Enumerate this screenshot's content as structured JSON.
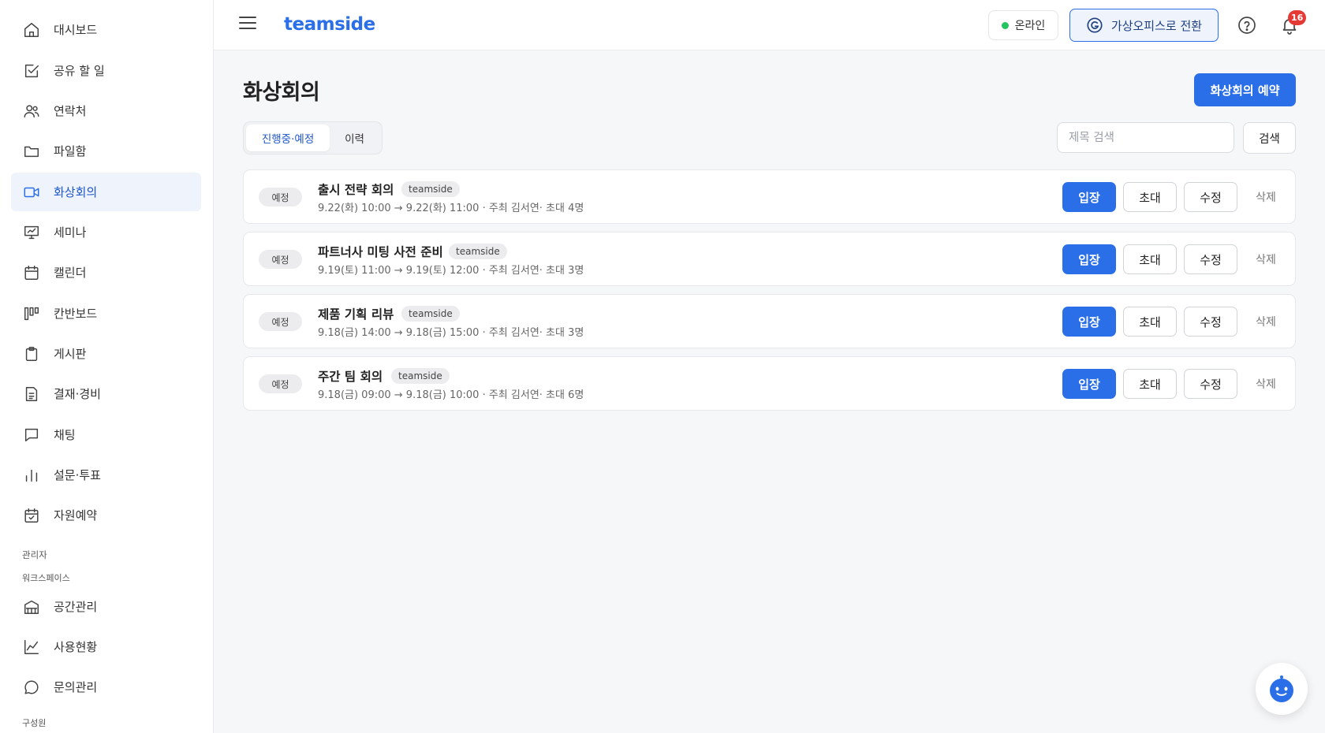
{
  "sidebar": {
    "items": [
      {
        "label": "대시보드",
        "icon": "home-icon"
      },
      {
        "label": "공유 할 일",
        "icon": "checkbox-icon"
      },
      {
        "label": "연락처",
        "icon": "users-icon"
      },
      {
        "label": "파일함",
        "icon": "folder-icon"
      },
      {
        "label": "화상회의",
        "icon": "video-icon"
      },
      {
        "label": "세미나",
        "icon": "presentation-icon"
      },
      {
        "label": "캘린더",
        "icon": "calendar-icon"
      },
      {
        "label": "칸반보드",
        "icon": "kanban-icon"
      },
      {
        "label": "게시판",
        "icon": "clipboard-icon"
      },
      {
        "label": "결재·경비",
        "icon": "document-icon"
      },
      {
        "label": "채팅",
        "icon": "chat-icon"
      },
      {
        "label": "설문·투표",
        "icon": "bar-chart-icon"
      },
      {
        "label": "자원예약",
        "icon": "calendar-check-icon"
      }
    ],
    "admin_label": "관리자",
    "workspace_label": "워크스페이스",
    "admin_items": [
      {
        "label": "공간관리",
        "icon": "building-icon"
      },
      {
        "label": "사용현황",
        "icon": "line-chart-icon"
      },
      {
        "label": "문의관리",
        "icon": "message-circle-icon"
      }
    ],
    "members_label": "구성원"
  },
  "header": {
    "logo": "teamside",
    "status": "온라인",
    "status_color": "#22c55e",
    "virtual_office_label": "가상오피스로 전환",
    "notification_count": "16"
  },
  "main": {
    "title": "화상회의",
    "reserve_button": "화상회의 예약",
    "tabs": [
      {
        "label": "진행중·예정",
        "active": true
      },
      {
        "label": "이력",
        "active": false
      }
    ],
    "search": {
      "placeholder": "제목 검색",
      "button": "검색"
    },
    "meetings": [
      {
        "status": "예정",
        "title": "출시 전략 회의",
        "tag": "teamside",
        "meta": "9.22(화) 10:00 → 9.22(화) 11:00 · 주최 김서연· 초대 4명"
      },
      {
        "status": "예정",
        "title": "파트너사 미팅 사전 준비",
        "tag": "teamside",
        "meta": "9.19(토) 11:00 → 9.19(토) 12:00 · 주최 김서연· 초대 3명"
      },
      {
        "status": "예정",
        "title": "제품 기획 리뷰",
        "tag": "teamside",
        "meta": "9.18(금) 14:00 → 9.18(금) 15:00 · 주최 김서연· 초대 3명"
      },
      {
        "status": "예정",
        "title": "주간 팀 회의",
        "tag": "teamside",
        "meta": "9.18(금) 09:00 → 9.18(금) 10:00 · 주최 김서연· 초대 6명"
      }
    ],
    "actions": {
      "enter": "입장",
      "invite": "초대",
      "edit": "수정",
      "delete": "삭제"
    }
  },
  "colors": {
    "accent": "#2b6fe8",
    "badge": "#e53935",
    "active_bg": "#eef3fc"
  }
}
